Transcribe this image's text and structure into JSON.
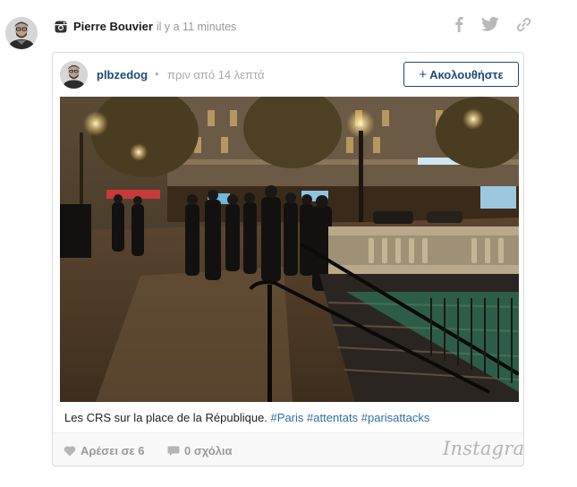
{
  "post": {
    "author": "Pierre Bouvier",
    "time": "il y a 11 minutes",
    "source_icon": "instagram-icon",
    "share_icons": [
      "facebook-icon",
      "twitter-icon",
      "link-icon"
    ]
  },
  "embed": {
    "username": "plbzedog",
    "separator": "•",
    "time": "πριν από 14 λεπτά",
    "follow": {
      "icon": "+",
      "label": "Ακολουθήστε"
    },
    "caption": {
      "text": "Les CRS sur la place de la République.",
      "hashtags": [
        "#Paris",
        "#attentats",
        "#parisattacks"
      ]
    },
    "likes": "Αρέσει σε 6",
    "comments": "0 σχόλια",
    "brand": "Instagram"
  },
  "colors": {
    "link": "#1e4a7a",
    "hashtag": "#2f6fa8",
    "muted": "#999999",
    "border": "#dbdbdb"
  }
}
